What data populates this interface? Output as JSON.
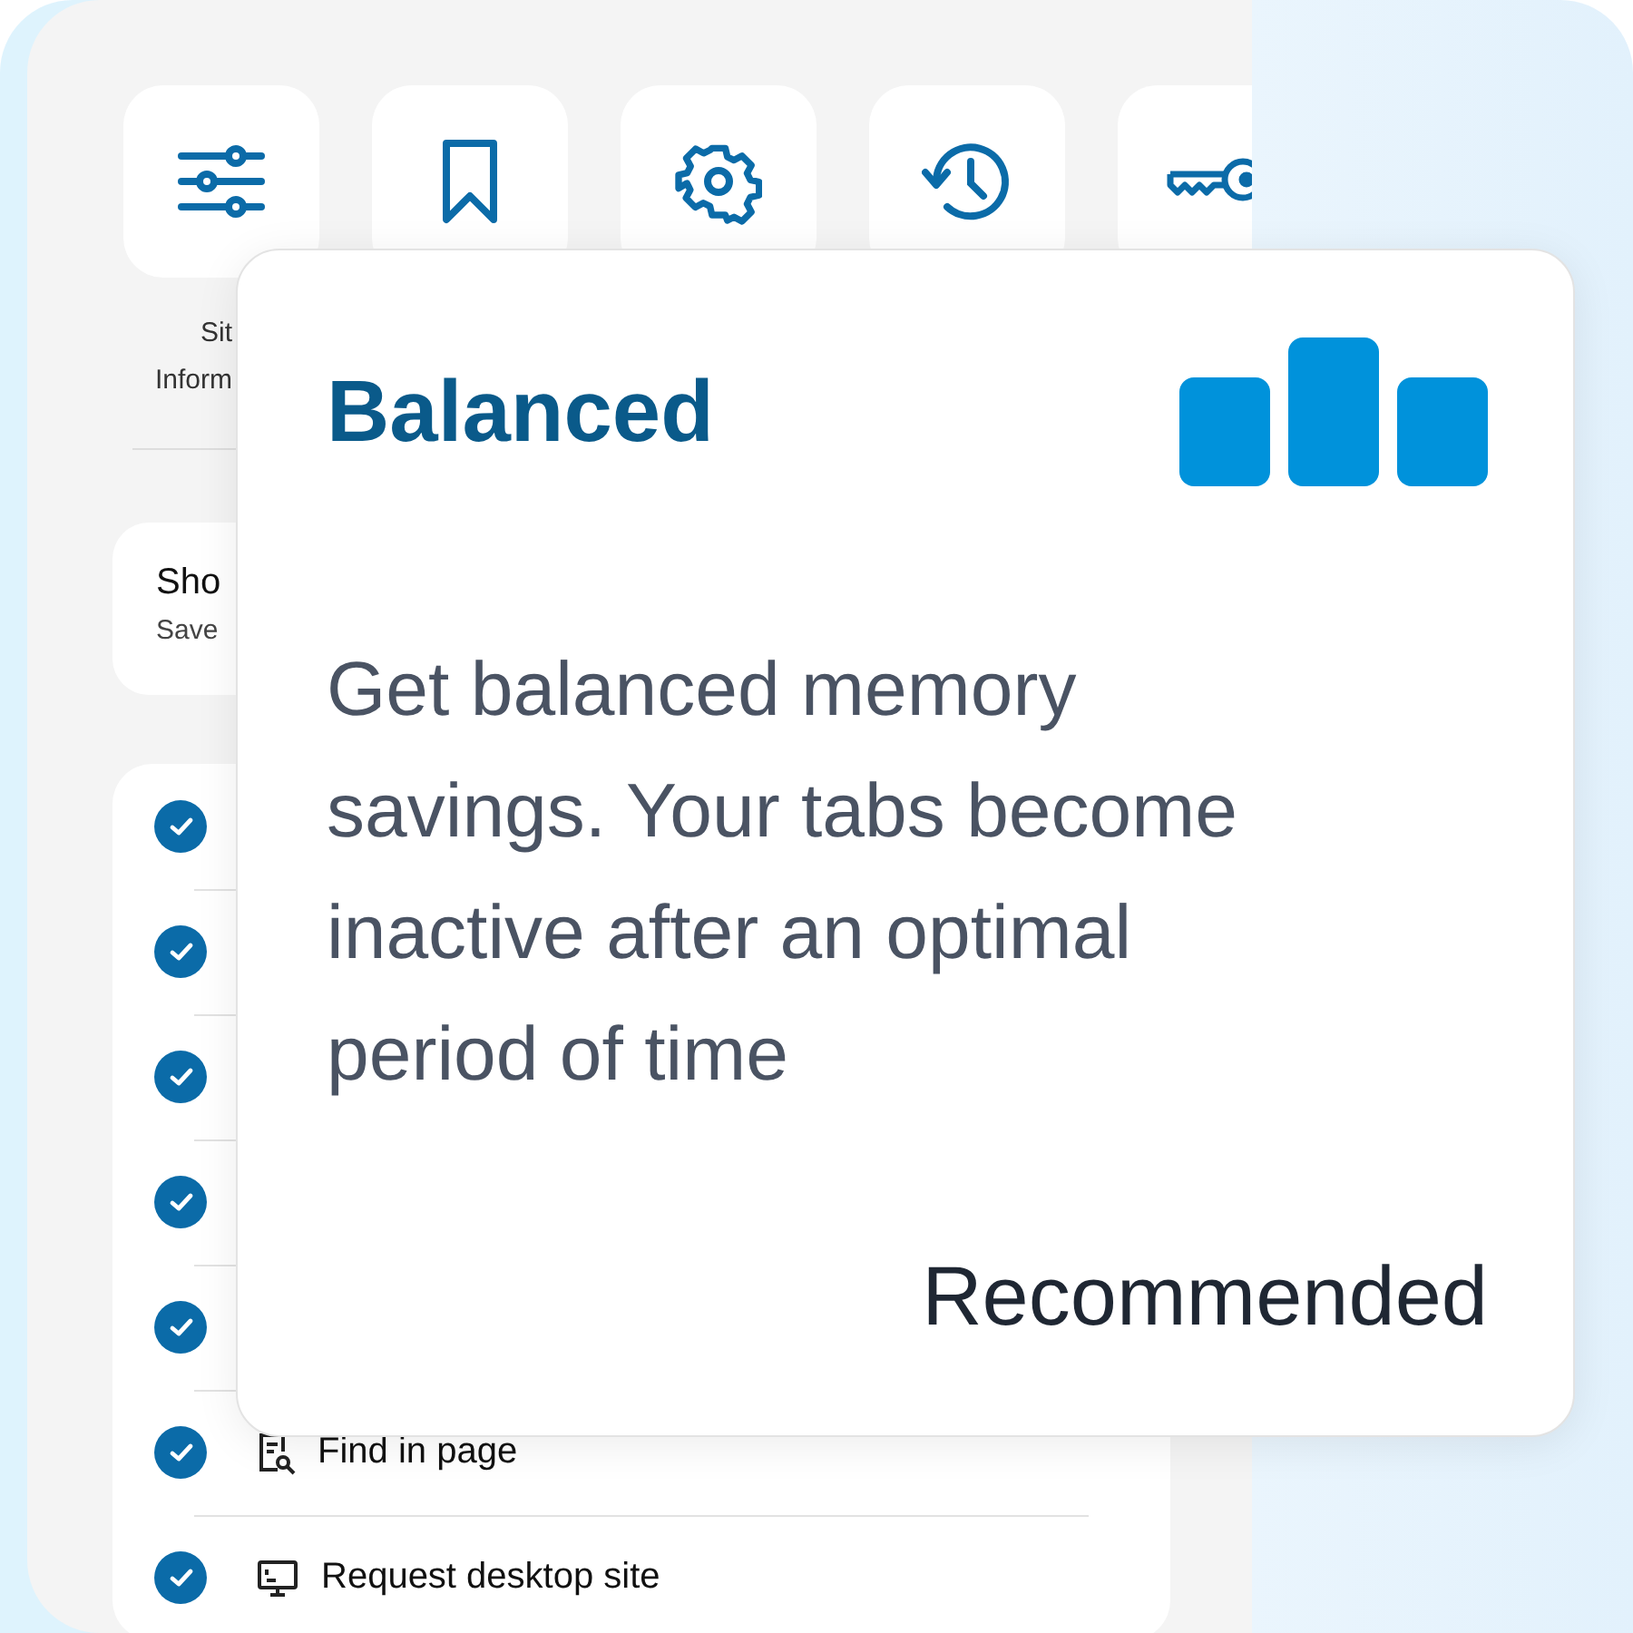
{
  "toolbar": {
    "tiles": [
      {
        "kind": "sliders",
        "label_lines": [
          "Sit",
          "Inform"
        ]
      },
      {
        "kind": "bookmark"
      },
      {
        "kind": "gear"
      },
      {
        "kind": "history"
      },
      {
        "kind": "key"
      }
    ]
  },
  "setting_row": {
    "title": "Sho",
    "subtitle": "Save"
  },
  "checklist": [
    {
      "checked": true
    },
    {
      "checked": true
    },
    {
      "checked": true
    },
    {
      "checked": true
    },
    {
      "checked": true
    },
    {
      "checked": true,
      "kind": "find",
      "label": "Find in page"
    },
    {
      "checked": true,
      "kind": "desktop",
      "label": "Request desktop site"
    }
  ],
  "card": {
    "title": "Balanced",
    "description": "Get balanced memory savings. Your tabs become inactive after an optimal period of time",
    "badge": "Recommended"
  }
}
